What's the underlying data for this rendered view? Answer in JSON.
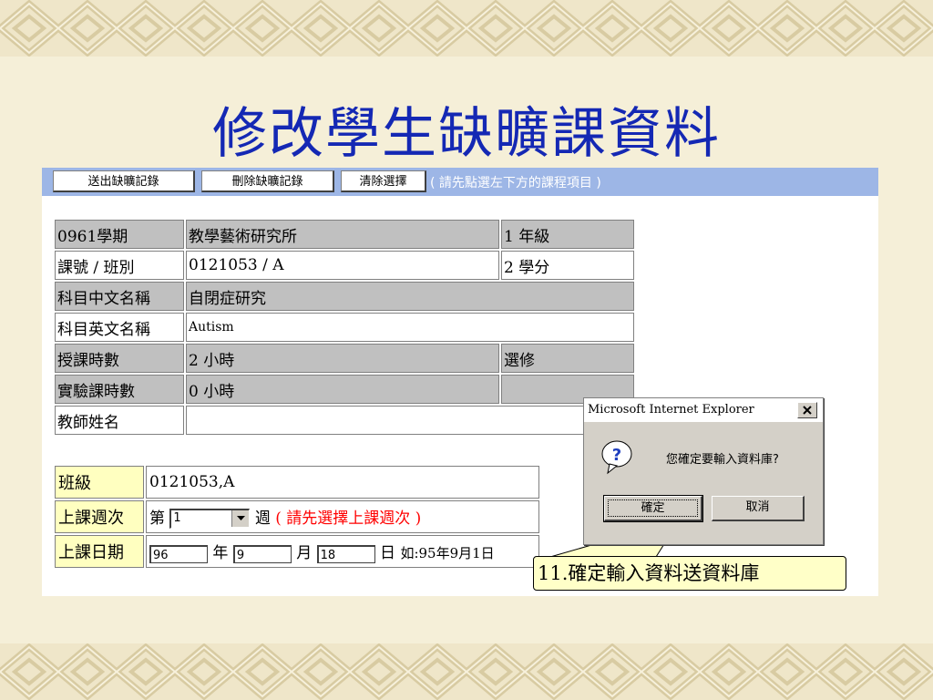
{
  "page": {
    "title": "修改學生缺曠課資料"
  },
  "toolbar": {
    "submit_label": "送出缺曠記錄",
    "delete_label": "刪除缺曠記錄",
    "clear_label": "清除選擇",
    "hint": "( 請先點選左下方的課程項目 )"
  },
  "course_info": {
    "rows": [
      [
        "0961學期",
        "教學藝術研究所",
        "1 年級"
      ],
      [
        "課號 / 班別",
        "0121053 / A",
        "2 學分"
      ],
      [
        "科目中文名稱",
        "自閉症研究"
      ],
      [
        "科目英文名稱",
        "Autism"
      ],
      [
        "授課時數",
        "2 小時",
        "選修"
      ],
      [
        "實驗課時數",
        "0 小時",
        ""
      ],
      [
        "教師姓名",
        ""
      ]
    ]
  },
  "class_form": {
    "class_label": "班級",
    "class_value": "0121053,A",
    "week_label": "上課週次",
    "week_prefix": "第",
    "week_value": "1",
    "week_suffix": "週",
    "week_hint": "( 請先選擇上課週次 )",
    "date_label": "上課日期",
    "year_value": "96",
    "year_unit": "年",
    "month_value": "9",
    "month_unit": "月",
    "day_value": "18",
    "day_unit": "日",
    "date_example": "如:95年9月1日"
  },
  "dialog": {
    "title": "Microsoft Internet Explorer",
    "message": "您確定要輸入資料庫?",
    "ok_label": "確定",
    "cancel_label": "取消"
  },
  "callout": {
    "text": "11.確定輸入資料送資料庫"
  },
  "colors": {
    "title": "#1428b4",
    "toolbar": "#9db6e6",
    "background": "#f5efd8",
    "label_cell": "#ffffc0",
    "hint_red": "#ff0000"
  }
}
